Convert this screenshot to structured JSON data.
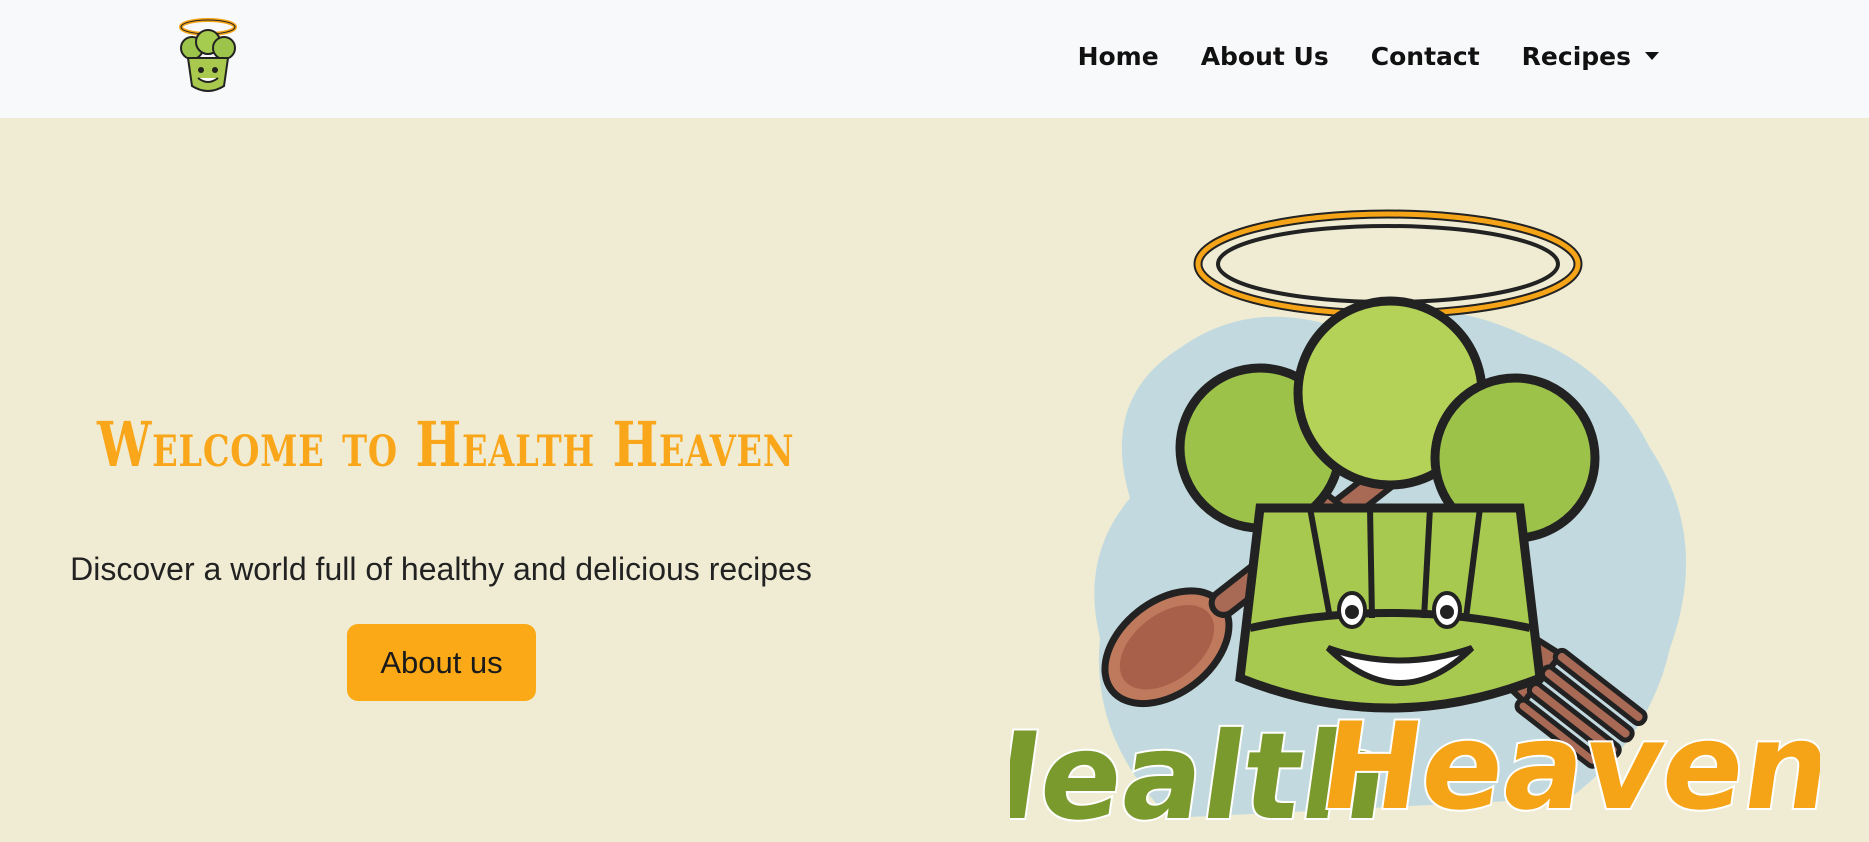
{
  "nav": {
    "logo_icon": "health-heaven-chef-logo-icon",
    "items": [
      {
        "label": "Home"
      },
      {
        "label": "About Us"
      },
      {
        "label": "Contact"
      },
      {
        "label": "Recipes",
        "dropdown": true
      }
    ]
  },
  "hero": {
    "title": "Welcome to Health Heaven",
    "subtitle": "Discover a world full of healthy and delicious recipes",
    "button_label": "About us",
    "logo": {
      "icon": "health-heaven-logo-illustration",
      "word1": "Health",
      "word2": "Heaven"
    }
  },
  "colors": {
    "background": "#f0ecd3",
    "navbar": "#f8f9fa",
    "accent": "#f9a61a",
    "button": "#fba917",
    "logo_green": "#7a9a2e"
  }
}
